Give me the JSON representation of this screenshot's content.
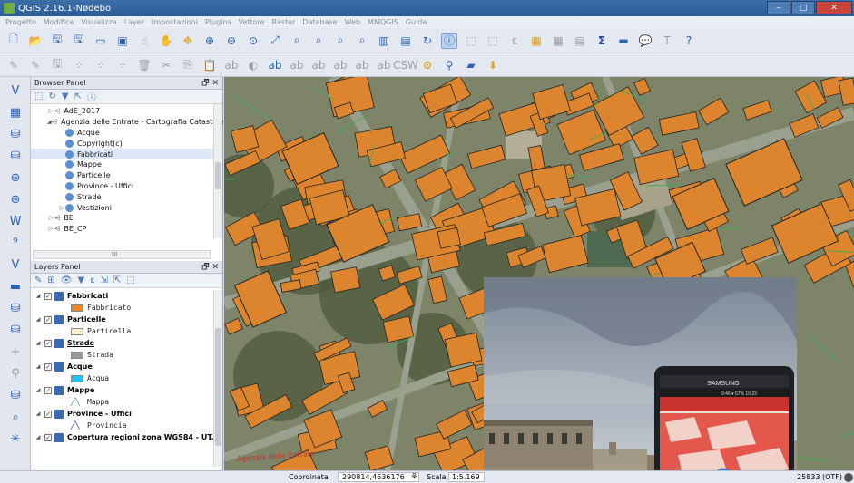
{
  "window": {
    "title": "QGIS 2.16.1-Nødebo",
    "min": "‒",
    "max": "□",
    "close": "✕"
  },
  "menu": [
    "Progetto",
    "Modifica",
    "Visualizza",
    "Layer",
    "Impostazioni",
    "Plugins",
    "Vettore",
    "Raster",
    "Database",
    "Web",
    "MMQGIS",
    "Guida"
  ],
  "toolbar": {
    "sigma": "Σ",
    "csw": "CSW",
    "help": "?"
  },
  "browser_panel": {
    "title": "Browser Panel",
    "controls": "🗗 ✕",
    "items": [
      {
        "label": "AdE_2017",
        "kind": "conn",
        "indent": 1,
        "arrow": "▷"
      },
      {
        "label": "Agenzia delle Entrate - Cartografia Catastale",
        "kind": "conn",
        "indent": 1,
        "arrow": "◢"
      },
      {
        "label": "Acque",
        "kind": "wms",
        "indent": 2
      },
      {
        "label": "Copyright(c)",
        "kind": "wms",
        "indent": 2
      },
      {
        "label": "Fabbricati",
        "kind": "wms",
        "indent": 2,
        "highlight": true
      },
      {
        "label": "Mappe",
        "kind": "wms",
        "indent": 2
      },
      {
        "label": "Particelle",
        "kind": "wms",
        "indent": 2
      },
      {
        "label": "Province - Uffici",
        "kind": "wms",
        "indent": 2
      },
      {
        "label": "Strade",
        "kind": "wms",
        "indent": 2
      },
      {
        "label": "Vestizioni",
        "kind": "wms",
        "indent": 2,
        "arrow": "▷"
      },
      {
        "label": "BE",
        "kind": "conn",
        "indent": 1,
        "arrow": "▷"
      },
      {
        "label": "BE_CP",
        "kind": "conn",
        "indent": 1,
        "arrow": "▷"
      }
    ],
    "hscroll_grip": "III"
  },
  "layers_panel": {
    "title": "Layers Panel",
    "controls": "🗗 ✕",
    "layers": [
      {
        "name": "Fabbricati",
        "style": "bold",
        "symbol": "Fabbricato",
        "symbol_color": "#e8882a"
      },
      {
        "name": "Particelle",
        "style": "bold",
        "symbol": "Particella",
        "symbol_color": "#fbefc9"
      },
      {
        "name": "Strade",
        "style": "bold-underline",
        "symbol": "Strada",
        "symbol_color": "#9a9a9a"
      },
      {
        "name": "Acque",
        "style": "bold",
        "symbol": "Acqua",
        "symbol_color": "#1fc3f0"
      },
      {
        "name": "Mappe",
        "style": "bold",
        "symbol": "Mappa",
        "symbol_color": "line-green"
      },
      {
        "name": "Province - Uffici",
        "style": "bold",
        "symbol": "Provincia",
        "symbol_color": "line-blue"
      },
      {
        "name": "Copertura regioni zona WGS84 - UT...",
        "style": "bold"
      }
    ]
  },
  "statusbar": {
    "coord_label": "Coordinata",
    "coord_value": "290814,4636176",
    "scale_label": "Scala",
    "scale_value": "1:5.169",
    "crs": "25833 (OTF)"
  },
  "map": {
    "watermark": "Agenzia delle Entrate",
    "phone": {
      "brand": "SAMSUNG",
      "status": "9:46 ▾ 57% 10:23"
    }
  },
  "colors": {
    "building": "#dc842e",
    "outline": "#222222",
    "parcel": "#3fae55",
    "road": "#9aa08e",
    "vegetation": "#4e5a3c"
  }
}
